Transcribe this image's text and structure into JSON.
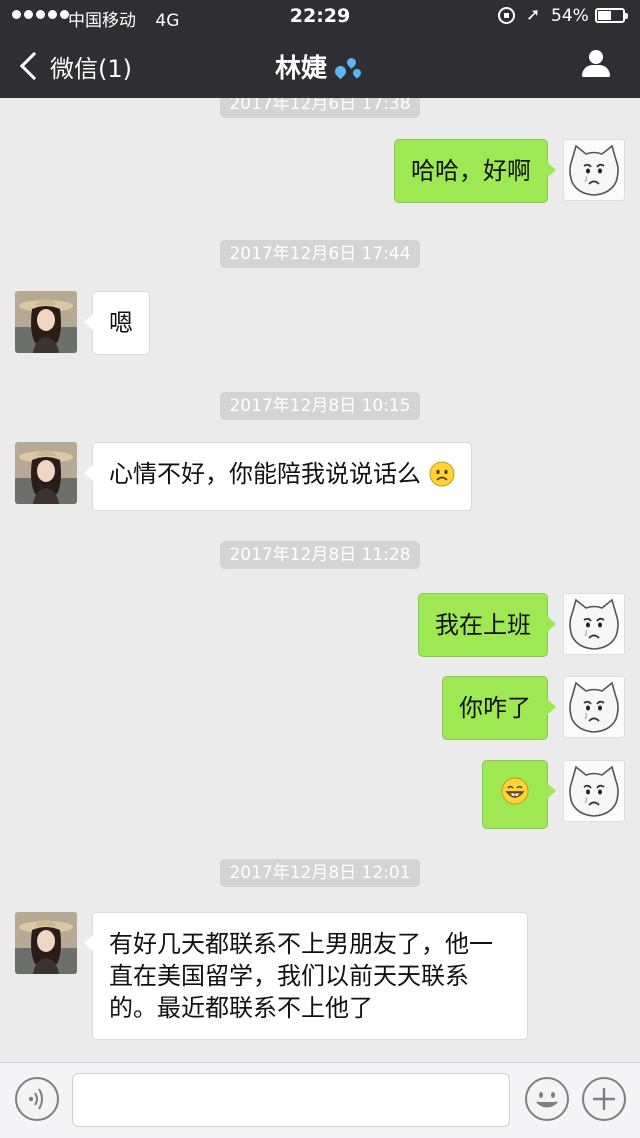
{
  "status_bar": {
    "carrier": "中国移动",
    "network": "4G",
    "time": "22:29",
    "battery_percent": "54%",
    "battery_level": 0.54
  },
  "nav": {
    "back_label": "微信(1)",
    "title": "林婕"
  },
  "colors": {
    "nav_background": "#2f2f33",
    "chat_background": "#ebebeb",
    "self_bubble": "#9ee854",
    "other_bubble": "#ffffff",
    "timestamp_pill": "#d4d4d4"
  },
  "messages": [
    {
      "type": "timestamp",
      "text": "2017年12月6日 17:38"
    },
    {
      "type": "message",
      "from": "self",
      "text": "哈哈，好啊"
    },
    {
      "type": "timestamp",
      "text": "2017年12月6日 17:44"
    },
    {
      "type": "message",
      "from": "other",
      "text": "嗯"
    },
    {
      "type": "timestamp",
      "text": "2017年12月8日 10:15"
    },
    {
      "type": "message",
      "from": "other",
      "text": "心情不好，你能陪我说说话么",
      "emoji": "frown-emoji"
    },
    {
      "type": "timestamp",
      "text": "2017年12月8日 11:28"
    },
    {
      "type": "message",
      "from": "self",
      "text": "我在上班"
    },
    {
      "type": "message",
      "from": "self",
      "text": "你咋了"
    },
    {
      "type": "message",
      "from": "self",
      "text": "",
      "emoji": "grin-emoji"
    },
    {
      "type": "timestamp",
      "text": "2017年12月8日 12:01"
    },
    {
      "type": "message",
      "from": "other",
      "text": "有好几天都联系不上男朋友了，他一直在美国留学，我们以前天天联系的。最近都联系不上他了"
    }
  ],
  "input_bar": {
    "placeholder": "",
    "icons": [
      "voice-icon",
      "emoji-face-icon",
      "plus-icon"
    ]
  }
}
